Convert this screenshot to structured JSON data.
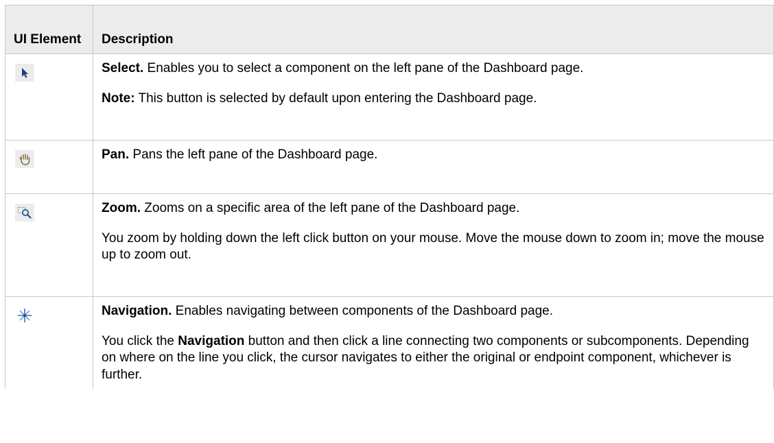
{
  "table": {
    "headers": {
      "col1": "UI Element",
      "col2": "Description"
    },
    "rows": [
      {
        "icon": "select-arrow-icon",
        "p1_bold": "Select.",
        "p1_text": " Enables you to select a component on the left pane of the Dashboard page.",
        "p2_bold": "Note:",
        "p2_text": " This button is selected by default upon entering the Dashboard page."
      },
      {
        "icon": "pan-hand-icon",
        "p1_bold": "Pan.",
        "p1_text": " Pans the left pane of the Dashboard page."
      },
      {
        "icon": "zoom-magnifier-icon",
        "p1_bold": "Zoom.",
        "p1_text": " Zooms on a specific area of the left pane of the Dashboard page.",
        "p2_text": "You zoom by holding down the left click button on your mouse. Move the mouse down to zoom in; move the mouse up to zoom out."
      },
      {
        "icon": "navigation-star-icon",
        "p1_bold": "Navigation.",
        "p1_text": " Enables navigating between components of the Dashboard page.",
        "p2_pre": "You click the ",
        "p2_bold": "Navigation",
        "p2_text": " button and then click a line connecting two components or subcomponents. Depending on where on the line you click, the cursor navigates to either the original or endpoint component, whichever is further."
      }
    ]
  }
}
